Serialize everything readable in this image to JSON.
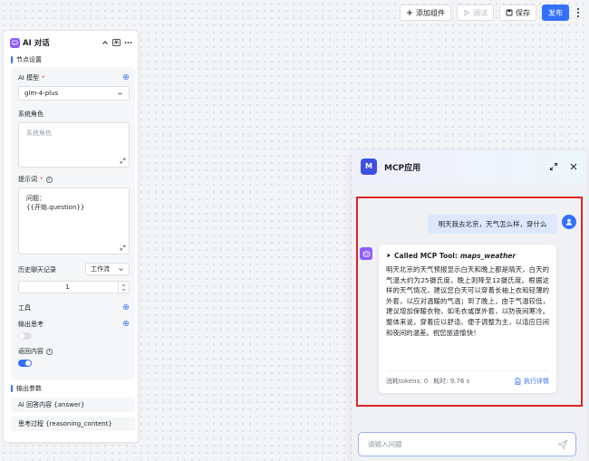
{
  "toolbar": {
    "add_component": "添加组件",
    "debug": "调试",
    "save": "保存",
    "publish": "发布"
  },
  "node": {
    "title": "AI 对话",
    "section_settings": "节点设置",
    "model_label": "AI 模型",
    "model_required": "*",
    "model_value": "glm-4-plus",
    "system_role_label": "系统角色",
    "system_role_placeholder": "系统角色",
    "prompt_label": "提示词",
    "prompt_required": "*",
    "prompt_value": "问题：\n{{开始.question}}",
    "history_label": "历史聊天记录",
    "history_mode": "工作流",
    "history_count": "1",
    "tools_label": "工具",
    "reasoning_label": "输出思考",
    "reasoning_enabled": false,
    "return_label": "返回内容",
    "return_enabled": true,
    "section_output": "输出参数",
    "outputs": [
      "AI 回答内容 {answer}",
      "思考过程 {reasoning_content}"
    ]
  },
  "chat": {
    "logo_letter": "M",
    "title": "MCP应用",
    "user_message": "明天我去北京，天气怎么样，穿什么",
    "tool_prefix": "Called MCP Tool:",
    "tool_name": "maps_weather",
    "answer": "明天北京的天气预报显示白天和晚上都是晴天，白天的气温大约为25摄氏度，晚上则降至12摄氏度。根据这样的天气情况，建议您白天可以穿着长袖上衣和轻薄的外套，以应对温暖的气温；到了晚上，由于气温较低，建议增加保暖衣物，如毛衣或厚外套，以防夜间寒冷。整体来说，穿着应以舒适、便于调整为主，以适应日间和夜间的温差。祝您旅途愉快！",
    "tokens": "消耗tokens: 0",
    "time": "耗时: 9.76 s",
    "detail_link": "执行详情",
    "input_placeholder": "请输入问题"
  },
  "colors": {
    "primary": "#3370ff",
    "node_icon": "#8f5cff",
    "chat_logo": "#3f4fe0",
    "highlight_border": "#e02424"
  }
}
